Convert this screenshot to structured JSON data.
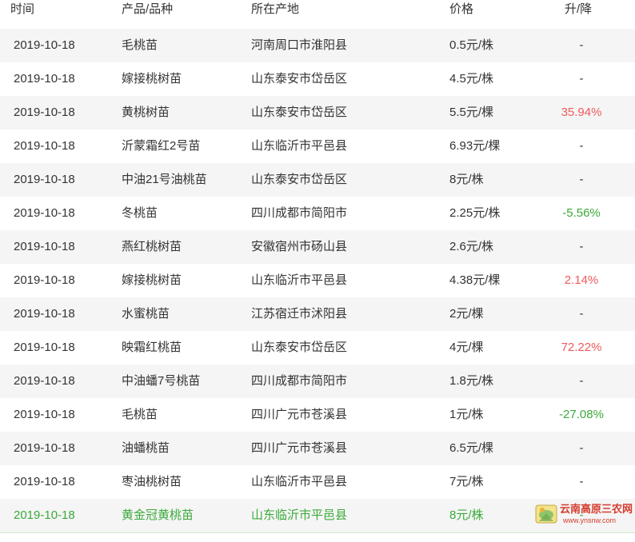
{
  "table": {
    "headers": {
      "date": "时间",
      "product": "产品/品种",
      "origin": "所在产地",
      "price": "价格",
      "change": "升/降"
    },
    "rows": [
      {
        "date": "2019-10-18",
        "product": "毛桃苗",
        "origin": "河南周口市淮阳县",
        "price": "0.5元/株",
        "change": "-",
        "trend": "flat"
      },
      {
        "date": "2019-10-18",
        "product": "嫁接桃树苗",
        "origin": "山东泰安市岱岳区",
        "price": "4.5元/株",
        "change": "-",
        "trend": "flat"
      },
      {
        "date": "2019-10-18",
        "product": "黄桃树苗",
        "origin": "山东泰安市岱岳区",
        "price": "5.5元/棵",
        "change": "35.94%",
        "trend": "up"
      },
      {
        "date": "2019-10-18",
        "product": "沂蒙霜红2号苗",
        "origin": "山东临沂市平邑县",
        "price": "6.93元/棵",
        "change": "-",
        "trend": "flat"
      },
      {
        "date": "2019-10-18",
        "product": "中油21号油桃苗",
        "origin": "山东泰安市岱岳区",
        "price": "8元/株",
        "change": "-",
        "trend": "flat"
      },
      {
        "date": "2019-10-18",
        "product": "冬桃苗",
        "origin": "四川成都市简阳市",
        "price": "2.25元/株",
        "change": "-5.56%",
        "trend": "down"
      },
      {
        "date": "2019-10-18",
        "product": "燕红桃树苗",
        "origin": "安徽宿州市砀山县",
        "price": "2.6元/株",
        "change": "-",
        "trend": "flat"
      },
      {
        "date": "2019-10-18",
        "product": "嫁接桃树苗",
        "origin": "山东临沂市平邑县",
        "price": "4.38元/棵",
        "change": "2.14%",
        "trend": "up"
      },
      {
        "date": "2019-10-18",
        "product": "水蜜桃苗",
        "origin": "江苏宿迁市沭阳县",
        "price": "2元/棵",
        "change": "-",
        "trend": "flat"
      },
      {
        "date": "2019-10-18",
        "product": "映霜红桃苗",
        "origin": "山东泰安市岱岳区",
        "price": "4元/棵",
        "change": "72.22%",
        "trend": "up"
      },
      {
        "date": "2019-10-18",
        "product": "中油蟠7号桃苗",
        "origin": "四川成都市简阳市",
        "price": "1.8元/株",
        "change": "-",
        "trend": "flat"
      },
      {
        "date": "2019-10-18",
        "product": "毛桃苗",
        "origin": "四川广元市苍溪县",
        "price": "1元/株",
        "change": "-27.08%",
        "trend": "down"
      },
      {
        "date": "2019-10-18",
        "product": "油蟠桃苗",
        "origin": "四川广元市苍溪县",
        "price": "6.5元/棵",
        "change": "-",
        "trend": "flat"
      },
      {
        "date": "2019-10-18",
        "product": "枣油桃树苗",
        "origin": "山东临沂市平邑县",
        "price": "7元/株",
        "change": "-",
        "trend": "flat"
      },
      {
        "date": "2019-10-18",
        "product": "黄金冠黄桃苗",
        "origin": "山东临沂市平邑县",
        "price": "8元/株",
        "change": "-",
        "trend": "flat"
      }
    ]
  },
  "watermark": {
    "name": "云南高原三农网",
    "url": "www.ynsnw.com",
    "icon": "farm-logo-icon"
  },
  "colors": {
    "up": "#f05a5a",
    "down": "#3aaa3a",
    "row_alt": "#f5f5f5",
    "highlight": "#3aaa3a"
  }
}
